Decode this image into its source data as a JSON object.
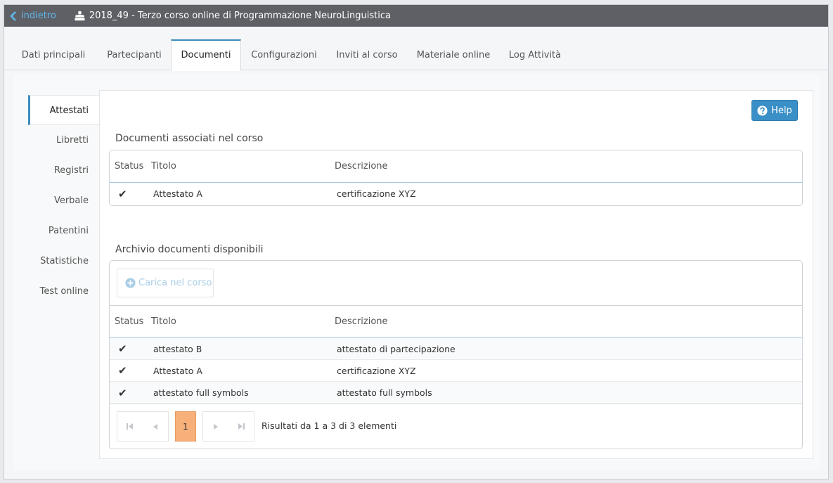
{
  "topbar": {
    "back_label": "indietro",
    "course_title": "2018_49 - Terzo corso online di Programmazione NeuroLinguistica"
  },
  "tabs": [
    {
      "label": "Dati principali",
      "active": false
    },
    {
      "label": "Partecipanti",
      "active": false
    },
    {
      "label": "Documenti",
      "active": true
    },
    {
      "label": "Configurazioni",
      "active": false
    },
    {
      "label": "Inviti al corso",
      "active": false
    },
    {
      "label": "Materiale online",
      "active": false
    },
    {
      "label": "Log Attività",
      "active": false
    }
  ],
  "sidenav": [
    {
      "label": "Attestati",
      "active": true
    },
    {
      "label": "Libretti"
    },
    {
      "label": "Registri"
    },
    {
      "label": "Verbale"
    },
    {
      "label": "Patentini"
    },
    {
      "label": "Statistiche"
    },
    {
      "label": "Test online"
    }
  ],
  "help_label": "Help",
  "associated": {
    "title": "Documenti associati nel corso",
    "columns": {
      "status": "Status",
      "title": "Titolo",
      "desc": "Descrizione"
    },
    "rows": [
      {
        "status": "✔",
        "title": "Attestato A",
        "desc": "certificazione XYZ"
      }
    ]
  },
  "archive": {
    "title": "Archivio documenti disponibili",
    "upload_label": "Carica nel corso",
    "columns": {
      "status": "Status",
      "title": "Titolo",
      "desc": "Descrizione"
    },
    "rows": [
      {
        "status": "✔",
        "title": "attestato B",
        "desc": "attestato di partecipazione"
      },
      {
        "status": "✔",
        "title": "Attestato A",
        "desc": "certificazione XYZ"
      },
      {
        "status": "✔",
        "title": "attestato full symbols",
        "desc": "attestato full symbols"
      }
    ],
    "pager": {
      "current": "1",
      "info": "Risultati da 1 a 3 di 3 elementi"
    }
  },
  "colors": {
    "accent": "#3c8dbc",
    "topbar": "#5f6066",
    "page_current": "#f8b07a",
    "link": "#5fb8ea"
  },
  "icons": {
    "back": "chevron-left-icon",
    "course": "people-group-icon",
    "help": "question-circle-icon",
    "upload": "plus-circle-icon"
  }
}
